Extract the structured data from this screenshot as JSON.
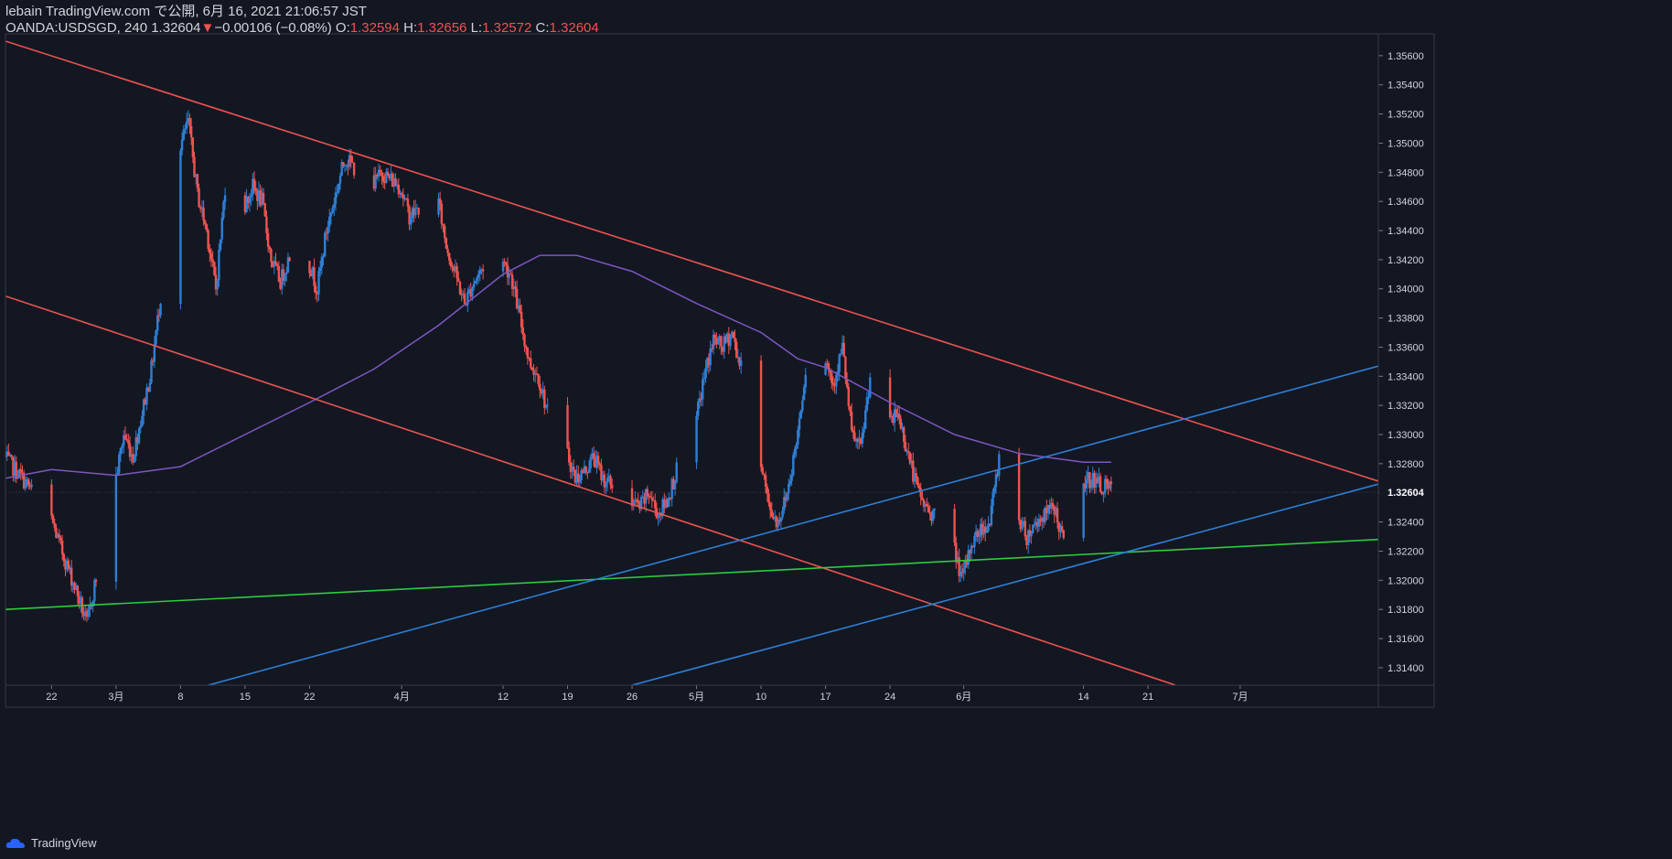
{
  "header": {
    "line1": "lebain TradingView.com で公開, 6月 16, 2021 21:06:57 JST",
    "symbol": "OANDA:USDSGD, 240",
    "last": "1.32604",
    "change_arrow": "▼",
    "change": "−0.00106 (−0.08%)",
    "o_label": "O:",
    "o_value": "1.32594",
    "h_label": "H:",
    "h_value": "1.32656",
    "l_label": "L:",
    "l_value": "1.32572",
    "c_label": "C:",
    "c_value": "1.32604"
  },
  "footer": {
    "brand": "TradingView"
  },
  "colors": {
    "background": "#131722",
    "up": "#2f7fd6",
    "down": "#ef5350",
    "ma": "#7e57c2",
    "trend_red": "#ef5350",
    "trend_blue": "#2f7fd6",
    "trend_green": "#2ecc40"
  },
  "chart_data": {
    "type": "candlestick",
    "symbol": "OANDA:USDSGD",
    "timeframe": "240",
    "ylim": [
      1.3128,
      1.3575
    ],
    "y_ticks": [
      1.314,
      1.316,
      1.318,
      1.32,
      1.322,
      1.324,
      1.326,
      1.328,
      1.33,
      1.332,
      1.334,
      1.336,
      1.338,
      1.34,
      1.342,
      1.344,
      1.346,
      1.348,
      1.35,
      1.352,
      1.354,
      1.356
    ],
    "y_tick_labels": [
      "1.31400",
      "1.31600",
      "1.31800",
      "1.32000",
      "1.32200",
      "1.32400",
      "",
      "1.32800",
      "1.33000",
      "1.33200",
      "1.33400",
      "1.33600",
      "1.33800",
      "1.34000",
      "1.34200",
      "1.34400",
      "1.34600",
      "1.34800",
      "1.35000",
      "1.35200",
      "1.35400",
      "1.35600"
    ],
    "x_start": "2021-02-17",
    "x_end": "2021-07-16",
    "x_ticks": [
      {
        "date": "2021-02-22",
        "label": "22"
      },
      {
        "date": "2021-03-01",
        "label": "3月"
      },
      {
        "date": "2021-03-08",
        "label": "8"
      },
      {
        "date": "2021-03-15",
        "label": "15"
      },
      {
        "date": "2021-03-22",
        "label": "22"
      },
      {
        "date": "2021-04-01",
        "label": "4月"
      },
      {
        "date": "2021-04-12",
        "label": "12"
      },
      {
        "date": "2021-04-19",
        "label": "19"
      },
      {
        "date": "2021-04-26",
        "label": "26"
      },
      {
        "date": "2021-05-03",
        "label": "5月"
      },
      {
        "date": "2021-05-10",
        "label": "10"
      },
      {
        "date": "2021-05-17",
        "label": "17"
      },
      {
        "date": "2021-05-24",
        "label": "24"
      },
      {
        "date": "2021-06-01",
        "label": "6月"
      },
      {
        "date": "2021-06-14",
        "label": "14"
      },
      {
        "date": "2021-06-21",
        "label": "21"
      },
      {
        "date": "2021-07-01",
        "label": "7月"
      }
    ],
    "last_price": 1.32604,
    "last_price_label": "1.32604",
    "close_path": [
      [
        "2021-02-17",
        1.3285
      ],
      [
        "2021-02-19",
        1.327
      ],
      [
        "2021-02-22",
        1.3245
      ],
      [
        "2021-02-23",
        1.3225
      ],
      [
        "2021-02-25",
        1.319
      ],
      [
        "2021-02-26",
        1.317
      ],
      [
        "2021-03-01",
        1.3265
      ],
      [
        "2021-03-02",
        1.33
      ],
      [
        "2021-03-03",
        1.3285
      ],
      [
        "2021-03-04",
        1.3315
      ],
      [
        "2021-03-05",
        1.3345
      ],
      [
        "2021-03-06",
        1.3395
      ],
      [
        "2021-03-07",
        1.343
      ],
      [
        "2021-03-08",
        1.3495
      ],
      [
        "2021-03-09",
        1.3515
      ],
      [
        "2021-03-10",
        1.3465
      ],
      [
        "2021-03-11",
        1.344
      ],
      [
        "2021-03-12",
        1.34
      ],
      [
        "2021-03-13",
        1.347
      ],
      [
        "2021-03-15",
        1.3455
      ],
      [
        "2021-03-16",
        1.347
      ],
      [
        "2021-03-17",
        1.346
      ],
      [
        "2021-03-18",
        1.342
      ],
      [
        "2021-03-19",
        1.3405
      ],
      [
        "2021-03-21",
        1.344
      ],
      [
        "2021-03-22",
        1.342
      ],
      [
        "2021-03-23",
        1.34
      ],
      [
        "2021-03-24",
        1.344
      ],
      [
        "2021-03-25",
        1.3465
      ],
      [
        "2021-03-26",
        1.349
      ],
      [
        "2021-03-29",
        1.347
      ],
      [
        "2021-03-30",
        1.348
      ],
      [
        "2021-03-31",
        1.3475
      ],
      [
        "2021-04-01",
        1.347
      ],
      [
        "2021-04-02",
        1.345
      ],
      [
        "2021-04-05",
        1.3465
      ],
      [
        "2021-04-06",
        1.343
      ],
      [
        "2021-04-07",
        1.341
      ],
      [
        "2021-04-08",
        1.339
      ],
      [
        "2021-04-09",
        1.3405
      ],
      [
        "2021-04-10",
        1.3415
      ],
      [
        "2021-04-12",
        1.342
      ],
      [
        "2021-04-13",
        1.341
      ],
      [
        "2021-04-14",
        1.338
      ],
      [
        "2021-04-15",
        1.335
      ],
      [
        "2021-04-16",
        1.334
      ],
      [
        "2021-04-17",
        1.3315
      ],
      [
        "2021-04-19",
        1.329
      ],
      [
        "2021-04-20",
        1.327
      ],
      [
        "2021-04-21",
        1.3275
      ],
      [
        "2021-04-22",
        1.3285
      ],
      [
        "2021-04-23",
        1.327
      ],
      [
        "2021-04-25",
        1.326
      ],
      [
        "2021-04-26",
        1.3255
      ],
      [
        "2021-04-27",
        1.325
      ],
      [
        "2021-04-28",
        1.326
      ],
      [
        "2021-04-29",
        1.3245
      ],
      [
        "2021-04-30",
        1.3255
      ],
      [
        "2021-05-01",
        1.3275
      ],
      [
        "2021-05-03",
        1.3305
      ],
      [
        "2021-05-04",
        1.334
      ],
      [
        "2021-05-05",
        1.3365
      ],
      [
        "2021-05-06",
        1.336
      ],
      [
        "2021-05-07",
        1.337
      ],
      [
        "2021-05-08",
        1.3345
      ],
      [
        "2021-05-10",
        1.329
      ],
      [
        "2021-05-11",
        1.325
      ],
      [
        "2021-05-12",
        1.324
      ],
      [
        "2021-05-13",
        1.326
      ],
      [
        "2021-05-14",
        1.3295
      ],
      [
        "2021-05-15",
        1.3345
      ],
      [
        "2021-05-17",
        1.3355
      ],
      [
        "2021-05-18",
        1.3335
      ],
      [
        "2021-05-19",
        1.336
      ],
      [
        "2021-05-20",
        1.33
      ],
      [
        "2021-05-21",
        1.329
      ],
      [
        "2021-05-22",
        1.334
      ],
      [
        "2021-05-23",
        1.332
      ],
      [
        "2021-05-24",
        1.3305
      ],
      [
        "2021-05-25",
        1.3315
      ],
      [
        "2021-05-26",
        1.329
      ],
      [
        "2021-05-27",
        1.3265
      ],
      [
        "2021-05-28",
        1.325
      ],
      [
        "2021-05-29",
        1.3245
      ],
      [
        "2021-05-30",
        1.324
      ],
      [
        "2021-05-31",
        1.3225
      ],
      [
        "2021-06-01",
        1.32
      ],
      [
        "2021-06-02",
        1.3225
      ],
      [
        "2021-06-03",
        1.3235
      ],
      [
        "2021-06-04",
        1.324
      ],
      [
        "2021-06-05",
        1.3285
      ],
      [
        "2021-06-06",
        1.3265
      ],
      [
        "2021-06-07",
        1.3245
      ],
      [
        "2021-06-08",
        1.323
      ],
      [
        "2021-06-09",
        1.324
      ],
      [
        "2021-06-10",
        1.3245
      ],
      [
        "2021-06-11",
        1.325
      ],
      [
        "2021-06-12",
        1.3225
      ],
      [
        "2021-06-13",
        1.3255
      ],
      [
        "2021-06-14",
        1.3265
      ],
      [
        "2021-06-15",
        1.327
      ],
      [
        "2021-06-16",
        1.3265
      ],
      [
        "2021-06-17",
        1.3262
      ]
    ],
    "moving_average": [
      [
        "2021-02-17",
        1.327
      ],
      [
        "2021-02-22",
        1.3276
      ],
      [
        "2021-03-01",
        1.3272
      ],
      [
        "2021-03-08",
        1.3278
      ],
      [
        "2021-03-15",
        1.33
      ],
      [
        "2021-03-22",
        1.3322
      ],
      [
        "2021-03-29",
        1.3345
      ],
      [
        "2021-04-05",
        1.3375
      ],
      [
        "2021-04-12",
        1.341
      ],
      [
        "2021-04-16",
        1.3423
      ],
      [
        "2021-04-20",
        1.3423
      ],
      [
        "2021-04-26",
        1.3412
      ],
      [
        "2021-05-03",
        1.339
      ],
      [
        "2021-05-10",
        1.337
      ],
      [
        "2021-05-14",
        1.3352
      ],
      [
        "2021-05-17",
        1.3346
      ],
      [
        "2021-05-24",
        1.3322
      ],
      [
        "2021-05-31",
        1.33
      ],
      [
        "2021-06-07",
        1.3287
      ],
      [
        "2021-06-14",
        1.3281
      ],
      [
        "2021-06-17",
        1.3281
      ]
    ],
    "trend_lines": [
      {
        "color": "red",
        "start": [
          "2021-02-17",
          1.357
        ],
        "end": [
          "2021-07-16",
          1.3268
        ]
      },
      {
        "color": "red",
        "start": [
          "2021-02-17",
          1.3395
        ],
        "end": [
          "2021-06-24",
          1.3128
        ]
      },
      {
        "color": "green",
        "start": [
          "2021-02-17",
          1.318
        ],
        "end": [
          "2021-07-16",
          1.3228
        ]
      },
      {
        "color": "blue",
        "start": [
          "2021-03-11",
          1.3128
        ],
        "end": [
          "2021-07-16",
          1.3347
        ]
      },
      {
        "color": "blue",
        "start": [
          "2021-04-26",
          1.3128
        ],
        "end": [
          "2021-07-16",
          1.3266
        ]
      }
    ]
  }
}
